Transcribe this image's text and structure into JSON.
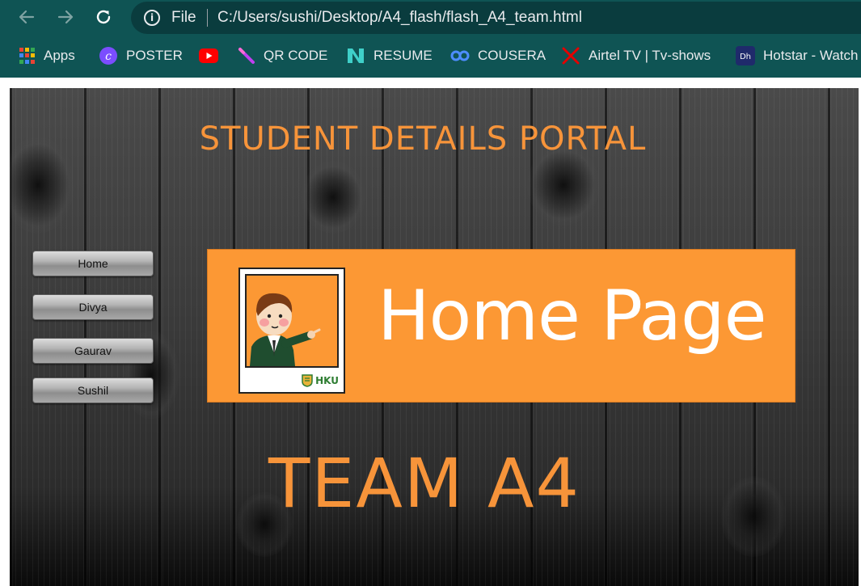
{
  "browser": {
    "info_icon": "info-icon",
    "file_label": "File",
    "url": "C:/Users/sushi/Desktop/A4_flash/flash_A4_team.html",
    "bookmarks": [
      {
        "label": "Apps",
        "icon": "apps-grid-icon"
      },
      {
        "label": "POSTER",
        "icon": "canva-icon",
        "color": "#7b4dff"
      },
      {
        "label": "",
        "icon": "youtube-icon",
        "color": "#ff0000"
      },
      {
        "label": "QR CODE",
        "icon": "wand-icon",
        "color": "#c040f0"
      },
      {
        "label": "RESUME",
        "icon": "novoresume-icon",
        "color": "#3fd0c9"
      },
      {
        "label": "COUSERA",
        "icon": "coursera-icon",
        "color": "#4d8dff"
      },
      {
        "label": "Airtel TV | Tv-shows",
        "icon": "airtel-icon",
        "color": "#e40000"
      },
      {
        "label": "Hotstar - Watch",
        "icon": "hotstar-icon",
        "color": "#1f2a6b"
      }
    ]
  },
  "page": {
    "title": "STUDENT DETAILS PORTAL",
    "nav": [
      {
        "label": "Home"
      },
      {
        "label": "Divya"
      },
      {
        "label": "Gaurav"
      },
      {
        "label": "Sushil"
      }
    ],
    "banner": {
      "heading": "Home Page",
      "logo_text": "HKU"
    },
    "team": "TEAM A4"
  },
  "colors": {
    "accent_orange": "#f7943a",
    "banner_orange": "#fc9834",
    "chrome_teal": "#0f5454"
  }
}
